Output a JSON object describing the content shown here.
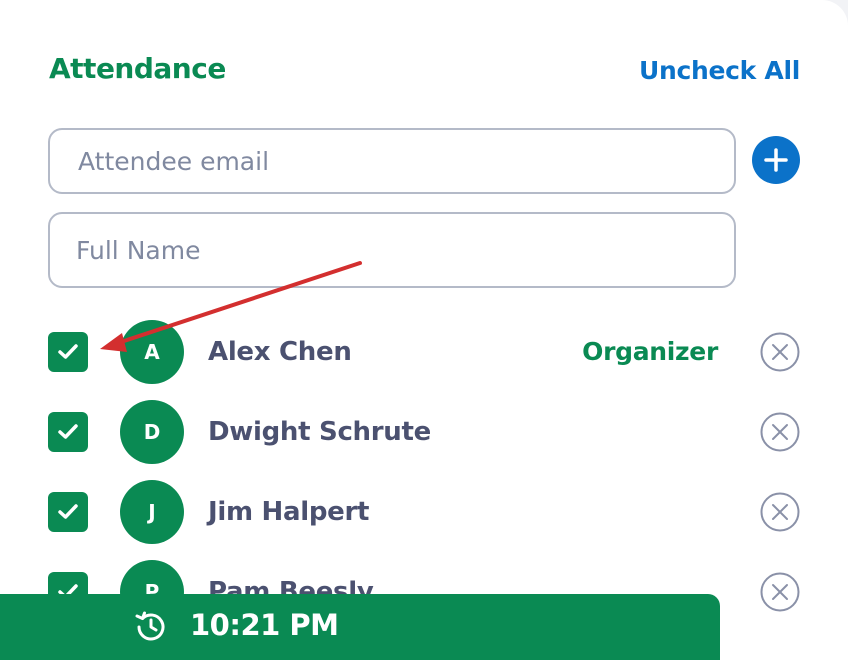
{
  "attendance": {
    "title": "Attendance",
    "uncheck_all_label": "Uncheck All",
    "email_placeholder": "Attendee email",
    "name_placeholder": "Full Name",
    "add_icon": "plus-circle-icon"
  },
  "attendees": [
    {
      "initial": "A",
      "name": "Alex Chen",
      "role": "Organizer",
      "checked": true
    },
    {
      "initial": "D",
      "name": "Dwight Schrute",
      "role": "",
      "checked": true
    },
    {
      "initial": "J",
      "name": "Jim Halpert",
      "role": "",
      "checked": true
    },
    {
      "initial": "P",
      "name": "Pam Beesly",
      "role": "",
      "checked": true
    }
  ],
  "timer": {
    "time": "10:21 PM",
    "icon": "history-clock-icon"
  },
  "colors": {
    "accent_green": "#0a8a53",
    "link_blue": "#0b72c9",
    "text_gray": "#4b5170",
    "annotation_red": "#d32f2f"
  }
}
